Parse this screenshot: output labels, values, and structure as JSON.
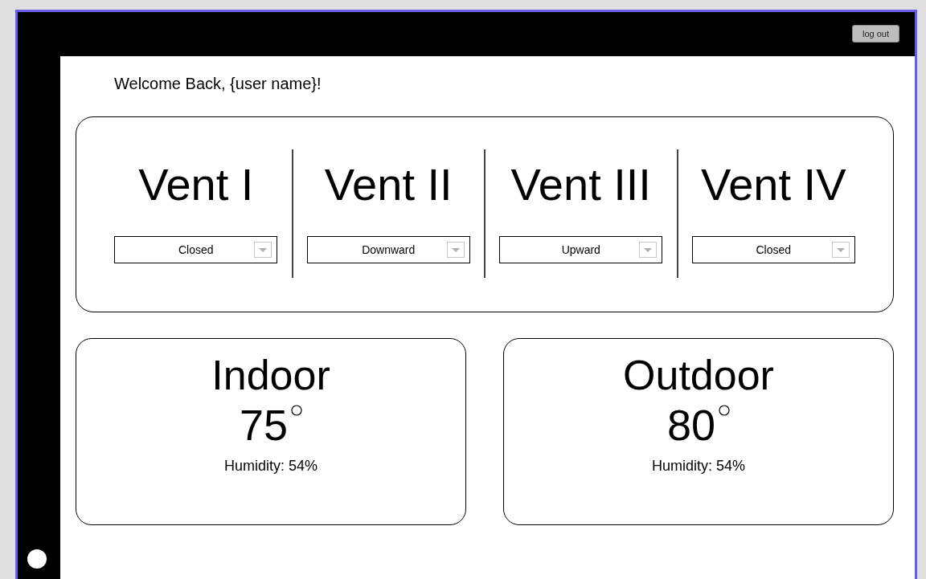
{
  "header": {
    "logout_button": "log out"
  },
  "welcome": "Welcome Back, {user name}!",
  "vents": [
    {
      "name": "Vent I",
      "setting": "Closed"
    },
    {
      "name": "Vent II",
      "setting": "Downward"
    },
    {
      "name": "Vent III",
      "setting": "Upward"
    },
    {
      "name": "Vent IV",
      "setting": "Closed"
    }
  ],
  "climate": [
    {
      "location": "Indoor",
      "temperature": "75",
      "humidity": "Humidity: 54%"
    },
    {
      "location": "Outdoor",
      "temperature": "80",
      "humidity": "Humidity: 54%"
    }
  ]
}
